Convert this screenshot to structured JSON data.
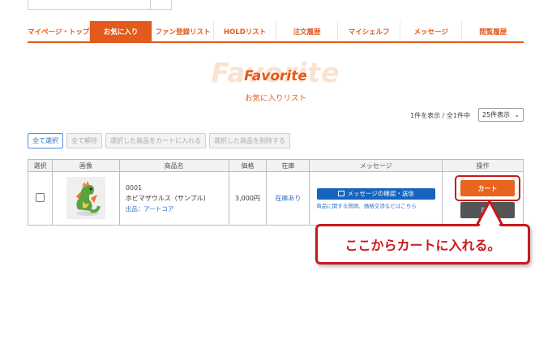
{
  "nav": {
    "tabs": [
      {
        "label": "マイページ・トップ"
      },
      {
        "label": "お気に入り",
        "active": true
      },
      {
        "label": "ファン登録リスト"
      },
      {
        "label": "HOLDリスト"
      },
      {
        "label": "注文履歴"
      },
      {
        "label": "マイシェルフ"
      },
      {
        "label": "メッセージ"
      },
      {
        "label": "閲覧履歴"
      }
    ]
  },
  "hero": {
    "bg_text": "Favorite",
    "title": "Favorite",
    "subtitle": "お気に入りリスト"
  },
  "count": {
    "text": "1件を表示 / 全1件中",
    "per_page": "25件表示"
  },
  "actions": {
    "select_all": "全て選択",
    "deselect_all": "全て解除",
    "add_selected_to_cart": "選択した商品をカートに入れる",
    "delete_selected": "選択した商品を削除する"
  },
  "table": {
    "headers": [
      "選択",
      "画像",
      "商品名",
      "価格",
      "在庫",
      "メッセージ",
      "操作"
    ],
    "rows": [
      {
        "code": "0001",
        "name": "ホビマザウルス（サンプル）",
        "seller": "出品：アートコア",
        "price": "3,000円",
        "stock": "在庫あり",
        "message_button": "メッセージの確認・送信",
        "message_note": "商品に関する質問、価格交渉などはこちら",
        "cart_button": "カート",
        "delete_button": "削除"
      }
    ]
  },
  "callout": {
    "text": "ここからカートに入れる。"
  },
  "colors": {
    "accent": "#e25a1c",
    "highlight": "#c8181f",
    "link": "#2c70c8",
    "message_button": "#1565c0"
  }
}
